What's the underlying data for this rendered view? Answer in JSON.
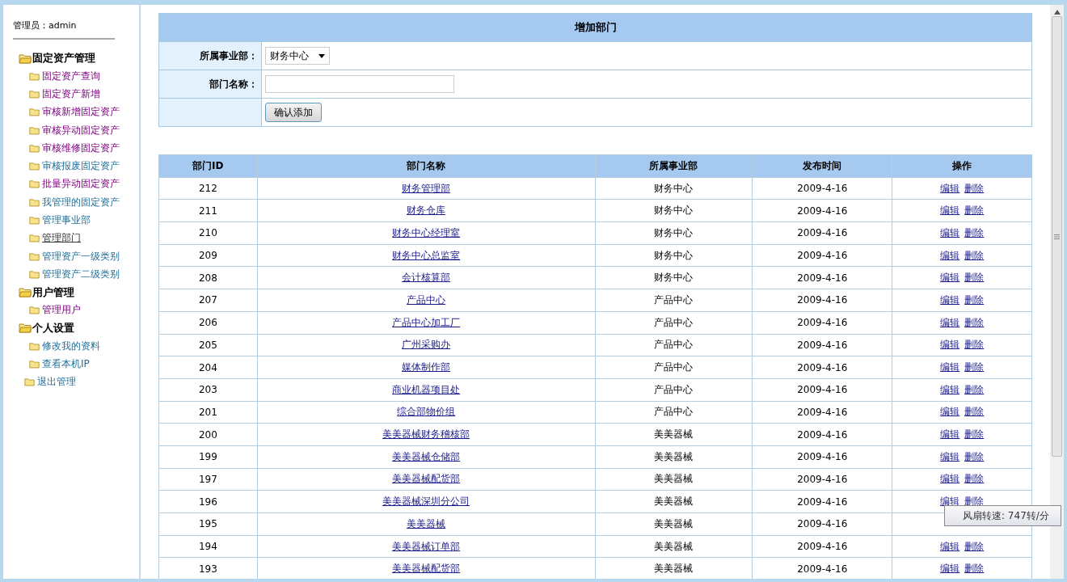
{
  "sidebar": {
    "admin_label": "管理员：admin",
    "groups": [
      {
        "title": "固定资产管理",
        "items": [
          {
            "label": "固定资产查询",
            "visited": true,
            "selected": false
          },
          {
            "label": "固定资产新增",
            "visited": true,
            "selected": false
          },
          {
            "label": "审核新增固定资产",
            "visited": true,
            "selected": false
          },
          {
            "label": "审核异动固定资产",
            "visited": true,
            "selected": false
          },
          {
            "label": "审核维修固定资产",
            "visited": true,
            "selected": false
          },
          {
            "label": "审核报废固定资产",
            "visited": false,
            "selected": false
          },
          {
            "label": "批量异动固定资产",
            "visited": true,
            "selected": false
          },
          {
            "label": "我管理的固定资产",
            "visited": false,
            "selected": false
          },
          {
            "label": "管理事业部",
            "visited": false,
            "selected": false
          },
          {
            "label": "管理部门",
            "visited": false,
            "selected": true
          },
          {
            "label": "管理资产一级类别",
            "visited": false,
            "selected": false
          },
          {
            "label": "管理资产二级类别",
            "visited": false,
            "selected": false
          }
        ]
      },
      {
        "title": "用户管理",
        "items": [
          {
            "label": "管理用户",
            "visited": true,
            "selected": false
          }
        ]
      },
      {
        "title": "个人设置",
        "items": [
          {
            "label": "修改我的资料",
            "visited": false,
            "selected": false
          },
          {
            "label": "查看本机IP",
            "visited": false,
            "selected": false
          }
        ]
      }
    ],
    "exit": {
      "label": "退出管理",
      "visited": false
    }
  },
  "form": {
    "title": "增加部门",
    "division_select": {
      "label": "所属事业部：",
      "value": "财务中心"
    },
    "name_field": {
      "label": "部门名称："
    },
    "submit_button": "确认添加"
  },
  "table": {
    "columns": [
      "部门ID",
      "部门名称",
      "所属事业部",
      "发布时间",
      "操作"
    ],
    "rows": [
      {
        "id": "212",
        "name": "财务管理部",
        "division": "财务中心",
        "date": "2009-4-16",
        "actions": [
          "编辑",
          "删除"
        ]
      },
      {
        "id": "211",
        "name": "财务仓库",
        "division": "财务中心",
        "date": "2009-4-16",
        "actions": [
          "编辑",
          "删除"
        ]
      },
      {
        "id": "210",
        "name": "财务中心经理室",
        "division": "财务中心",
        "date": "2009-4-16",
        "actions": [
          "编辑",
          "删除"
        ]
      },
      {
        "id": "209",
        "name": "财务中心总监室",
        "division": "财务中心",
        "date": "2009-4-16",
        "actions": [
          "编辑",
          "删除"
        ]
      },
      {
        "id": "208",
        "name": "会计核算部",
        "division": "财务中心",
        "date": "2009-4-16",
        "actions": [
          "编辑",
          "删除"
        ]
      },
      {
        "id": "207",
        "name": "产品中心",
        "division": "产品中心",
        "date": "2009-4-16",
        "actions": [
          "编辑",
          "删除"
        ]
      },
      {
        "id": "206",
        "name": "产品中心加工厂",
        "division": "产品中心",
        "date": "2009-4-16",
        "actions": [
          "编辑",
          "删除"
        ]
      },
      {
        "id": "205",
        "name": "广州采购办",
        "division": "产品中心",
        "date": "2009-4-16",
        "actions": [
          "编辑",
          "删除"
        ]
      },
      {
        "id": "204",
        "name": "媒体制作部",
        "division": "产品中心",
        "date": "2009-4-16",
        "actions": [
          "编辑",
          "删除"
        ]
      },
      {
        "id": "203",
        "name": "商业机器项目处",
        "division": "产品中心",
        "date": "2009-4-16",
        "actions": [
          "编辑",
          "删除"
        ]
      },
      {
        "id": "201",
        "name": "综合部物价组",
        "division": "产品中心",
        "date": "2009-4-16",
        "actions": [
          "编辑",
          "删除"
        ]
      },
      {
        "id": "200",
        "name": "美美器械财务稽核部",
        "division": "美美器械",
        "date": "2009-4-16",
        "actions": [
          "编辑",
          "删除"
        ]
      },
      {
        "id": "199",
        "name": "美美器械仓储部",
        "division": "美美器械",
        "date": "2009-4-16",
        "actions": [
          "编辑",
          "删除"
        ]
      },
      {
        "id": "197",
        "name": "美美器械配货部",
        "division": "美美器械",
        "date": "2009-4-16",
        "actions": [
          "编辑",
          "删除"
        ]
      },
      {
        "id": "196",
        "name": "美美器械深圳分公司",
        "division": "美美器械",
        "date": "2009-4-16",
        "actions": [
          "编辑",
          "删除"
        ]
      },
      {
        "id": "195",
        "name": "美美器械",
        "division": "美美器械",
        "date": "2009-4-16"
      },
      {
        "id": "194",
        "name": "美美器械订单部",
        "division": "美美器械",
        "date": "2009-4-16",
        "actions": [
          "编辑",
          "删除"
        ]
      },
      {
        "id": "193",
        "name": "美美器械配货部",
        "division": "美美器械",
        "date": "2009-4-16",
        "actions": [
          "编辑",
          "删除"
        ]
      }
    ]
  },
  "tooltip": {
    "text": "风扇转速: 747转/分"
  }
}
